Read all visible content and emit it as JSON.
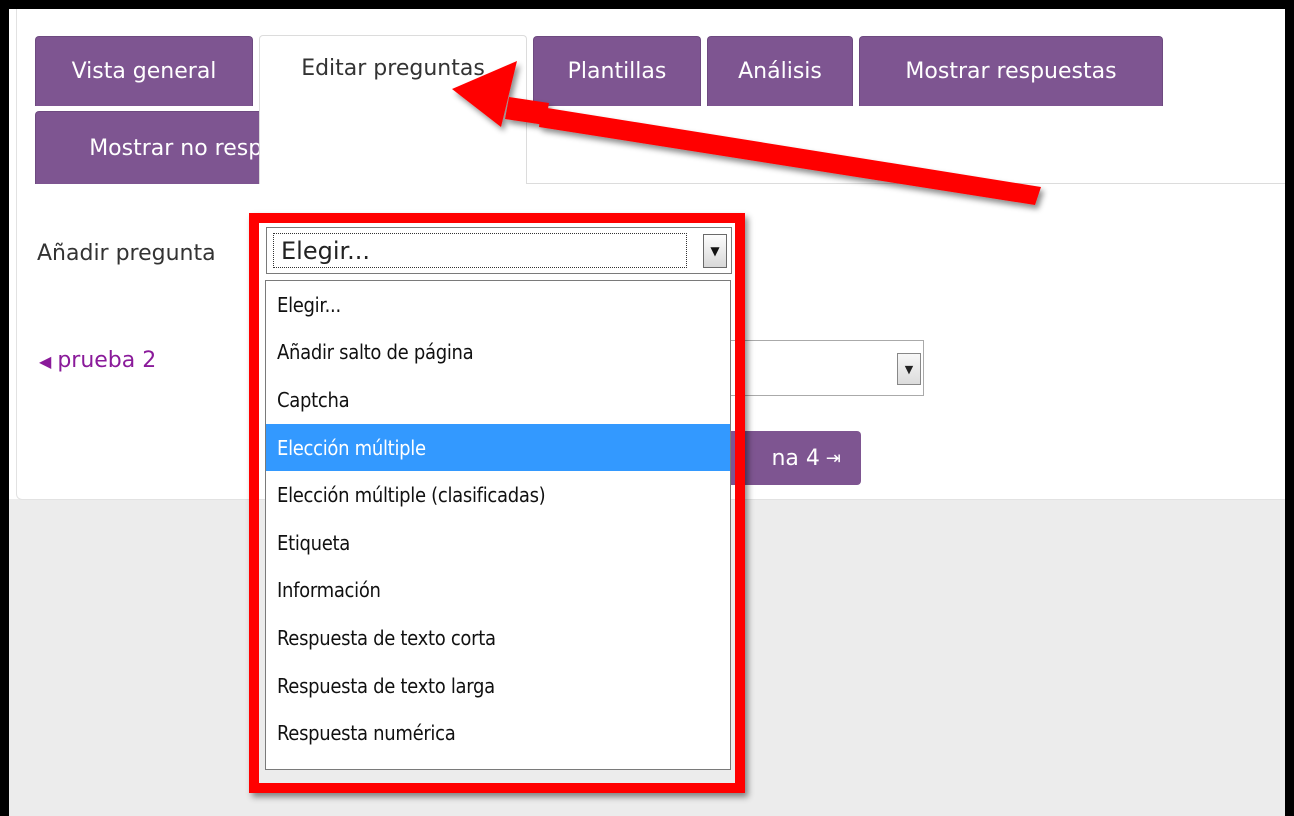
{
  "tabs": [
    {
      "label": "Vista general",
      "active": false
    },
    {
      "label": "Editar preguntas",
      "active": true
    },
    {
      "label": "Plantillas",
      "active": false
    },
    {
      "label": "Análisis",
      "active": false
    },
    {
      "label": "Mostrar respuestas",
      "active": false
    },
    {
      "label": "Mostrar no respondientes",
      "active": false
    }
  ],
  "add_question": {
    "label": "Añadir pregunta",
    "selected": "Elegir...",
    "options": [
      "Elegir...",
      "Añadir salto de página",
      "Captcha",
      "Elección múltiple",
      "Elección múltiple (clasificadas)",
      "Etiqueta",
      "Información",
      "Respuesta de texto corta",
      "Respuesta de texto larga",
      "Respuesta numérica"
    ],
    "highlighted": "Elección múltiple"
  },
  "navigation": {
    "prev_label": "prueba 2",
    "next_label": "na 4"
  },
  "colors": {
    "tab_bg": "#7e5591",
    "highlight": "#3399ff",
    "annotation": "#ff0000",
    "link": "#8a1a9a"
  }
}
